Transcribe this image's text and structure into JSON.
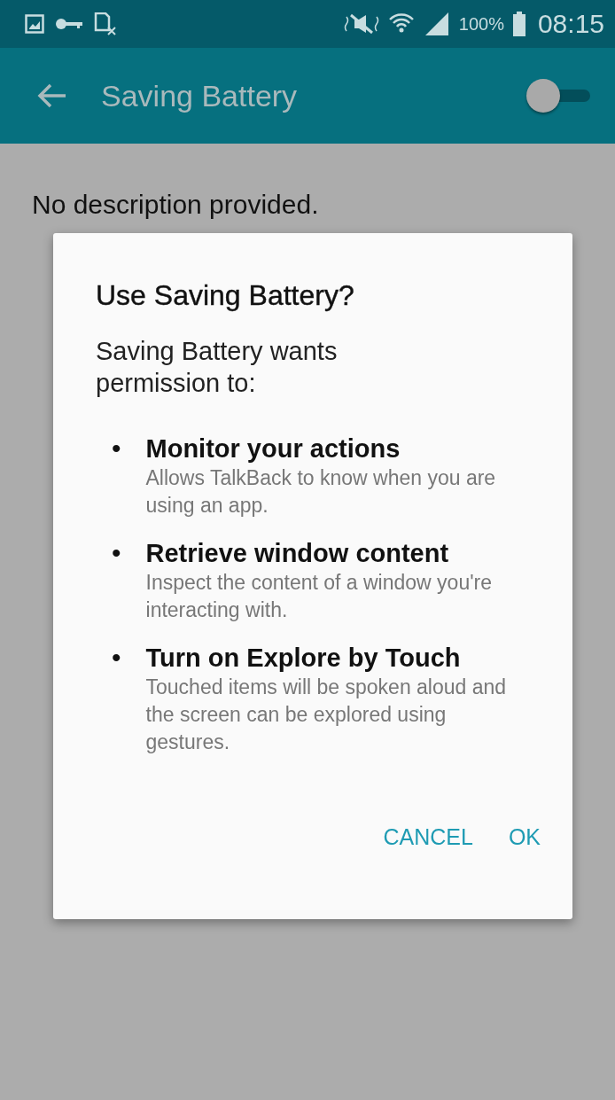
{
  "status_bar": {
    "battery": "100%",
    "time": "08:15"
  },
  "toolbar": {
    "title": "Saving Battery",
    "switch": {
      "on": false
    }
  },
  "content": {
    "description": "No description provided."
  },
  "dialog": {
    "title": "Use Saving Battery?",
    "message": "Saving Battery wants permission to:",
    "permissions": [
      {
        "bullet": "•",
        "title": "Monitor your actions",
        "description": "Allows TalkBack to know when you are using an app."
      },
      {
        "bullet": "•",
        "title": "Retrieve window content",
        "description": "Inspect the content of a window you're interacting with."
      },
      {
        "bullet": "•",
        "title": "Turn on Explore by Touch",
        "description": "Touched items will be spoken aloud and the screen can be explored using gestures."
      }
    ],
    "buttons": [
      "CANCEL",
      "OK"
    ]
  }
}
